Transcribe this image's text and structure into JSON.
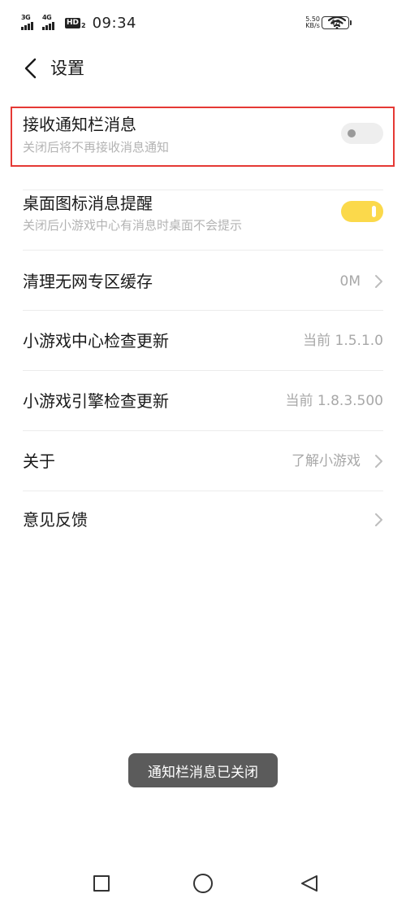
{
  "status_bar": {
    "signal_1": "3G",
    "signal_2": "4G",
    "hd_label": "HD",
    "hd_sub": "2",
    "time": "09:34",
    "speed_value": "5.50",
    "speed_unit": "KB/s",
    "battery": "48"
  },
  "header": {
    "title": "设置"
  },
  "settings": {
    "notification_bar": {
      "title": "接收通知栏消息",
      "subtitle": "关闭后将不再接收消息通知",
      "enabled": false
    },
    "desktop_badge": {
      "title": "桌面图标消息提醒",
      "subtitle": "关闭后小游戏中心有消息时桌面不会提示",
      "enabled": true
    },
    "clear_cache": {
      "title": "清理无网专区缓存",
      "value": "0M"
    },
    "center_update": {
      "title": "小游戏中心检查更新",
      "value": "当前 1.5.1.0"
    },
    "engine_update": {
      "title": "小游戏引擎检查更新",
      "value": "当前 1.8.3.500"
    },
    "about": {
      "title": "关于",
      "value": "了解小游戏"
    },
    "feedback": {
      "title": "意见反馈"
    }
  },
  "toast": {
    "message": "通知栏消息已关闭"
  },
  "colors": {
    "toggle_on": "#fbd94b",
    "toggle_off": "#eeeeee",
    "highlight_border": "#e53935",
    "toast_bg": "#5b5b5b"
  },
  "icons": {
    "back": "chevron-left-icon",
    "row_arrow": "chevron-right-icon",
    "wifi": "wifi-icon",
    "nav_recents": "square-icon",
    "nav_home": "circle-icon",
    "nav_back": "triangle-back-icon"
  }
}
